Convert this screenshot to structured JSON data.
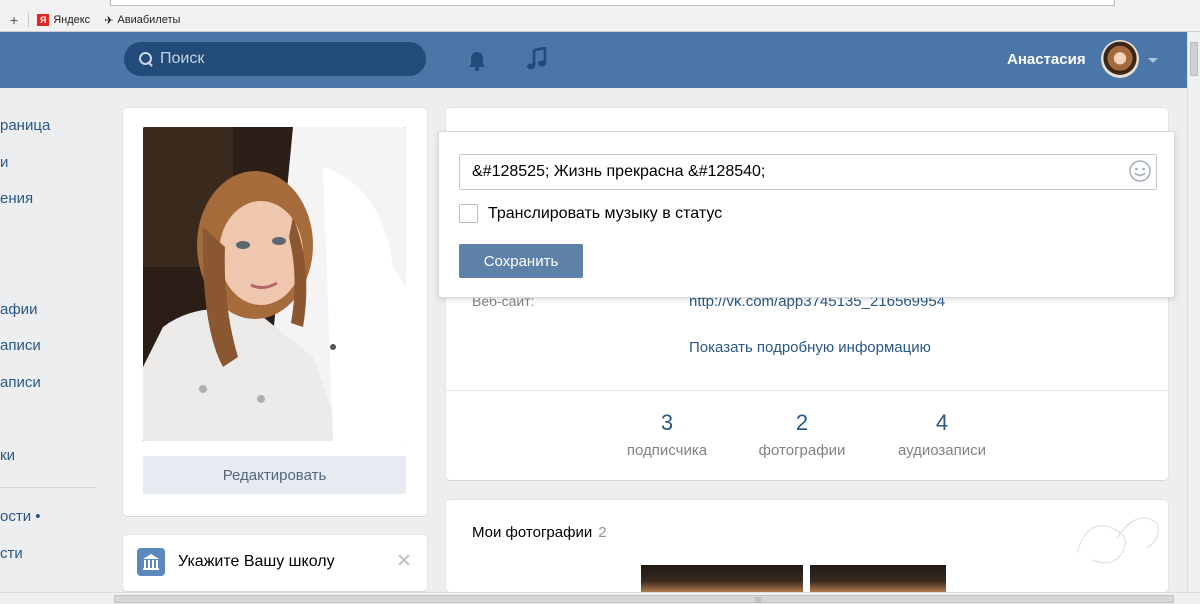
{
  "bookmarks": [
    {
      "label": "Яндекс"
    },
    {
      "label": "Авиабилеты"
    }
  ],
  "header": {
    "search_placeholder": "Поиск",
    "user_name": "Анастасия"
  },
  "left_menu": [
    {
      "label": "раница"
    },
    {
      "label": "и"
    },
    {
      "label": "ения"
    },
    {
      "label": "афии"
    },
    {
      "label": "аписи"
    },
    {
      "label": "аписи"
    },
    {
      "label": "ки"
    },
    {
      "label": "ости •"
    },
    {
      "label": "сти"
    }
  ],
  "profile": {
    "edit_label": "Редактировать",
    "school_prompt": "Укажите Вашу школу"
  },
  "status_popup": {
    "status_value": "&#128525; Жизнь прекрасна &#128540;",
    "broadcast_label": "Транслировать музыку в статус",
    "save_label": "Сохранить"
  },
  "info": {
    "website_label": "Веб-сайт:",
    "website_value": "http://vk.com/app3745135_216569954",
    "more_info_label": "Показать подробную информацию",
    "counters": [
      {
        "value": "3",
        "label": "подписчика"
      },
      {
        "value": "2",
        "label": "фотографии"
      },
      {
        "value": "4",
        "label": "аудиозаписи"
      }
    ]
  },
  "photos": {
    "title": "Мои фотографии",
    "count": "2"
  },
  "colors": {
    "header_bg": "#4a76a8",
    "link": "#2a5885",
    "page_bg": "#edeef0",
    "button": "#5e81a8"
  }
}
